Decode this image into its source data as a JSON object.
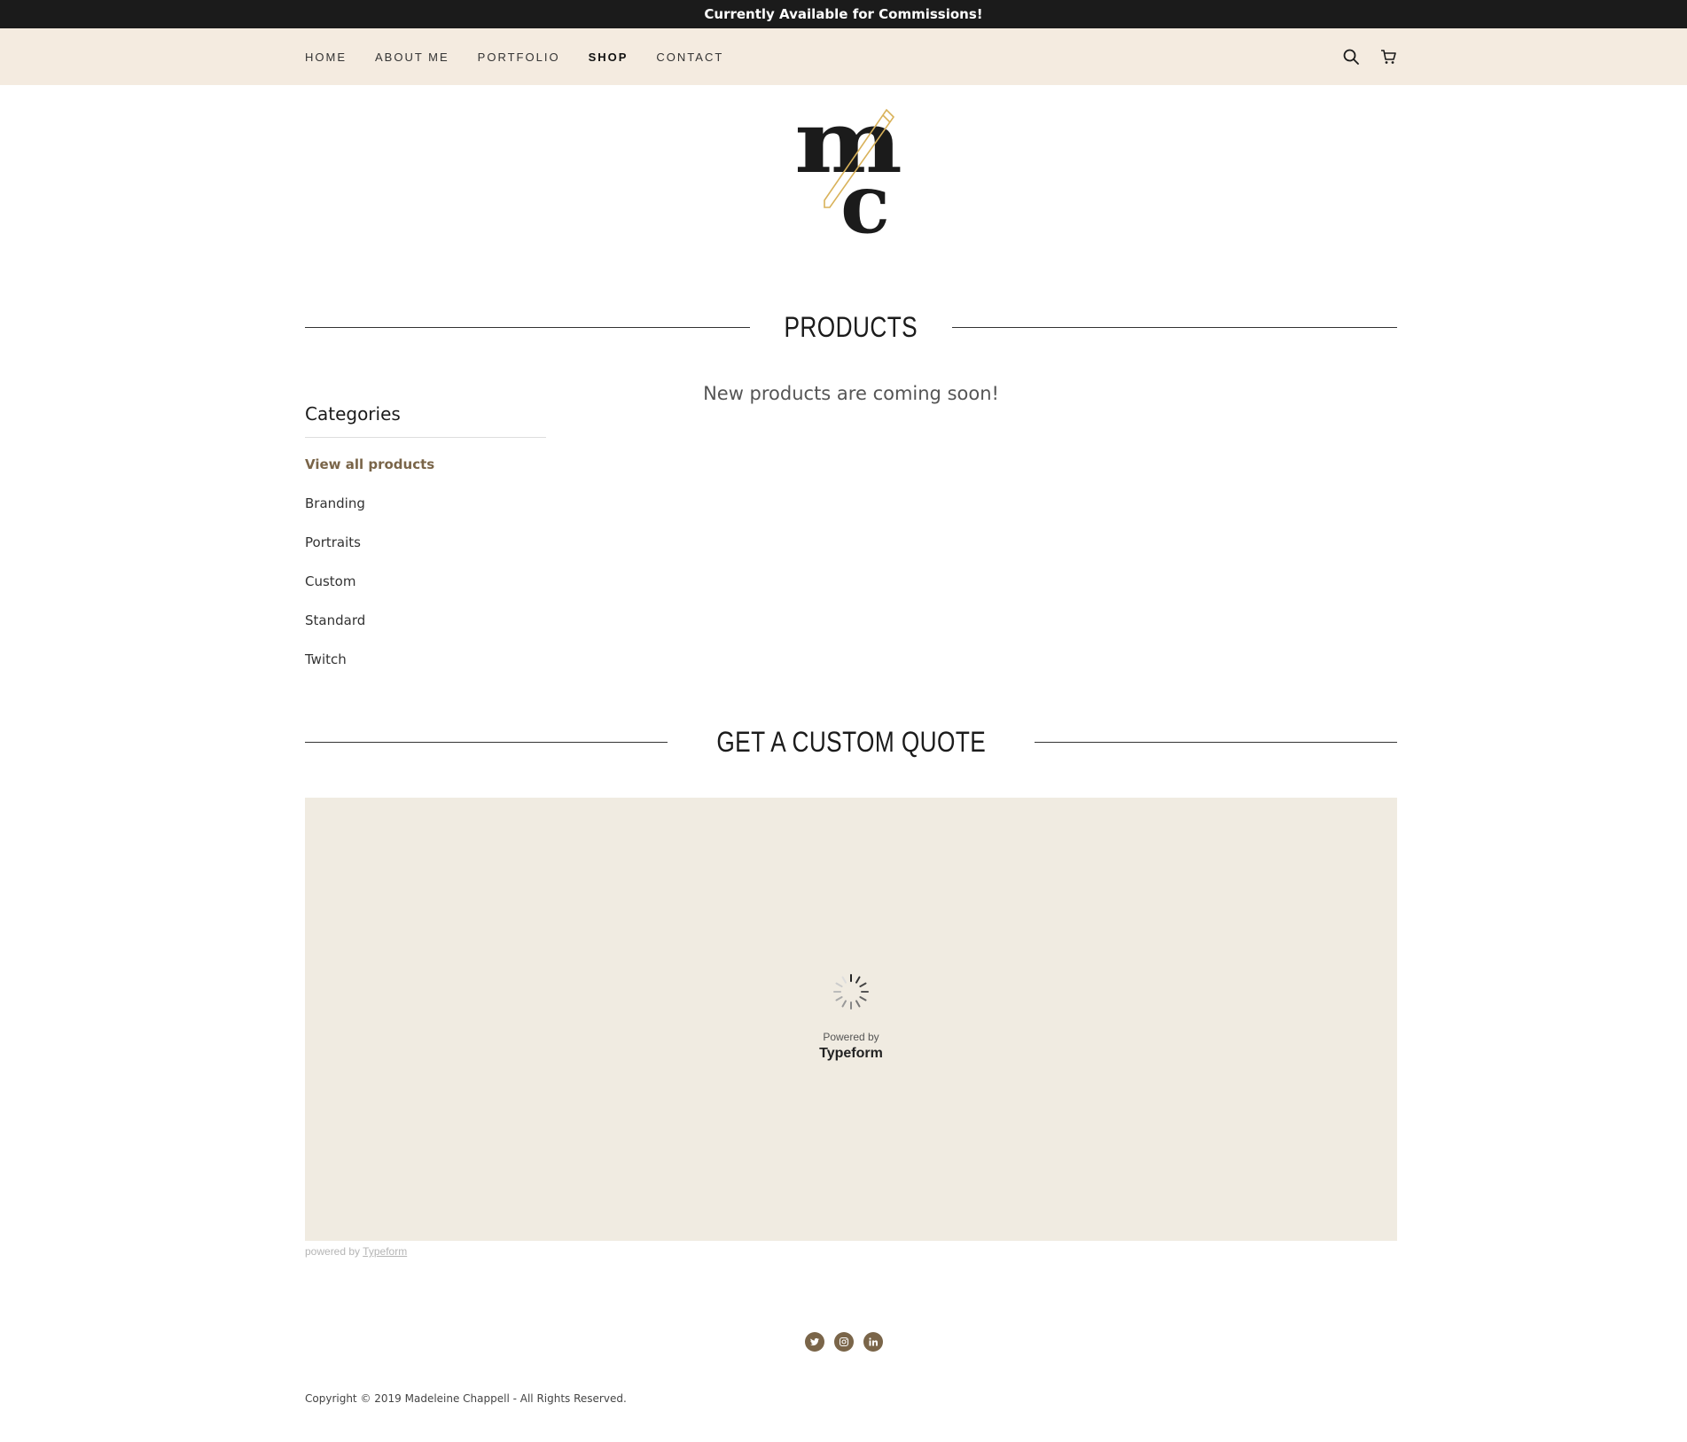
{
  "announcement": "Currently Available for Commissions!",
  "nav": {
    "items": [
      {
        "label": "HOME",
        "active": false
      },
      {
        "label": "ABOUT ME",
        "active": false
      },
      {
        "label": "PORTFOLIO",
        "active": false
      },
      {
        "label": "SHOP",
        "active": true
      },
      {
        "label": "CONTACT",
        "active": false
      }
    ],
    "icons": [
      "search-icon",
      "cart-icon"
    ]
  },
  "logo": {
    "letters": "mc"
  },
  "products": {
    "heading": "PRODUCTS",
    "empty_message": "New products are coming soon!"
  },
  "categories": {
    "title": "Categories",
    "items": [
      {
        "label": "View all products",
        "active": true
      },
      {
        "label": "Branding",
        "active": false
      },
      {
        "label": "Portraits",
        "active": false
      },
      {
        "label": "Custom",
        "active": false
      },
      {
        "label": "Standard",
        "active": false
      },
      {
        "label": "Twitch",
        "active": false
      }
    ]
  },
  "quote": {
    "heading": "GET A CUSTOM QUOTE",
    "powered_by": "Powered by",
    "brand": "Typeform",
    "footnote_prefix": "powered by",
    "footnote_link": "Typeform"
  },
  "social": [
    "twitter-icon",
    "instagram-icon",
    "linkedin-icon"
  ],
  "copyright": "Copyright © 2019 Madeleine Chappell - All Rights Reserved.",
  "colors": {
    "announcement_bg": "#1b1b1b",
    "nav_bg": "#f4ebe0",
    "accent": "#7a6549",
    "form_bg": "#f0ebe1",
    "pencil": "#d9b25a"
  }
}
